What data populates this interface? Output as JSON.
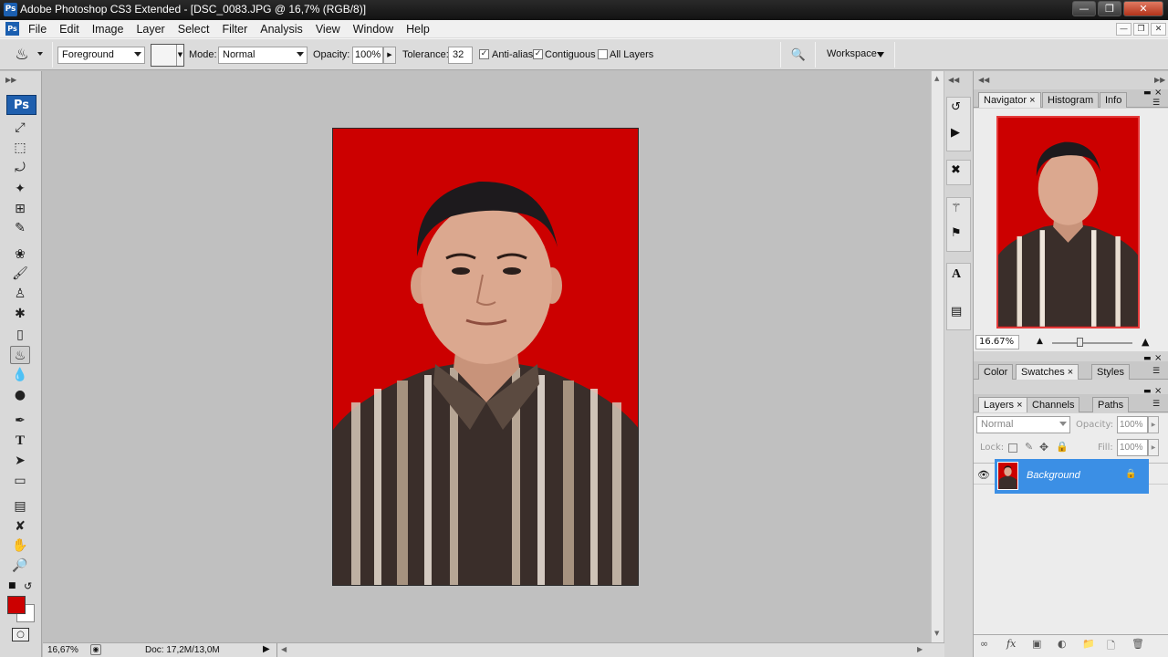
{
  "window": {
    "title": "Adobe Photoshop CS3 Extended - [DSC_0083.JPG @ 16,7% (RGB/8)]",
    "app_icon": "Ps"
  },
  "menu": [
    "File",
    "Edit",
    "Image",
    "Layer",
    "Select",
    "Filter",
    "Analysis",
    "View",
    "Window",
    "Help"
  ],
  "options": {
    "fill_source": "Foreground",
    "mode_label": "Mode:",
    "mode_value": "Normal",
    "opacity_label": "Opacity:",
    "opacity_value": "100%",
    "tolerance_label": "Tolerance:",
    "tolerance_value": "32",
    "anti_alias_label": "Anti-alias",
    "anti_alias_checked": true,
    "contiguous_label": "Contiguous",
    "contiguous_checked": true,
    "all_layers_label": "All Layers",
    "all_layers_checked": false,
    "workspace_label": "Workspace"
  },
  "tools": {
    "ps_logo": "Ps",
    "foreground_color": "#cc0000",
    "background_color": "#ffffff"
  },
  "status": {
    "zoom": "16,67%",
    "doc": "Doc: 17,2M/13,0M"
  },
  "navigator": {
    "tabs": [
      "Navigator",
      "Histogram",
      "Info"
    ],
    "zoom": "16.67%"
  },
  "color_panel": {
    "tabs": [
      "Color",
      "Swatches",
      "Styles"
    ]
  },
  "layers_panel": {
    "tabs": [
      "Layers",
      "Channels",
      "Paths"
    ],
    "blend_mode": "Normal",
    "opacity_label": "Opacity:",
    "opacity_value": "100%",
    "lock_label": "Lock:",
    "fill_label": "Fill:",
    "fill_value": "100%",
    "layers": [
      {
        "name": "Background",
        "selected": true
      }
    ]
  },
  "colors": {
    "photo_background": "#cc0000",
    "selection_blue": "#3b8fe5"
  }
}
